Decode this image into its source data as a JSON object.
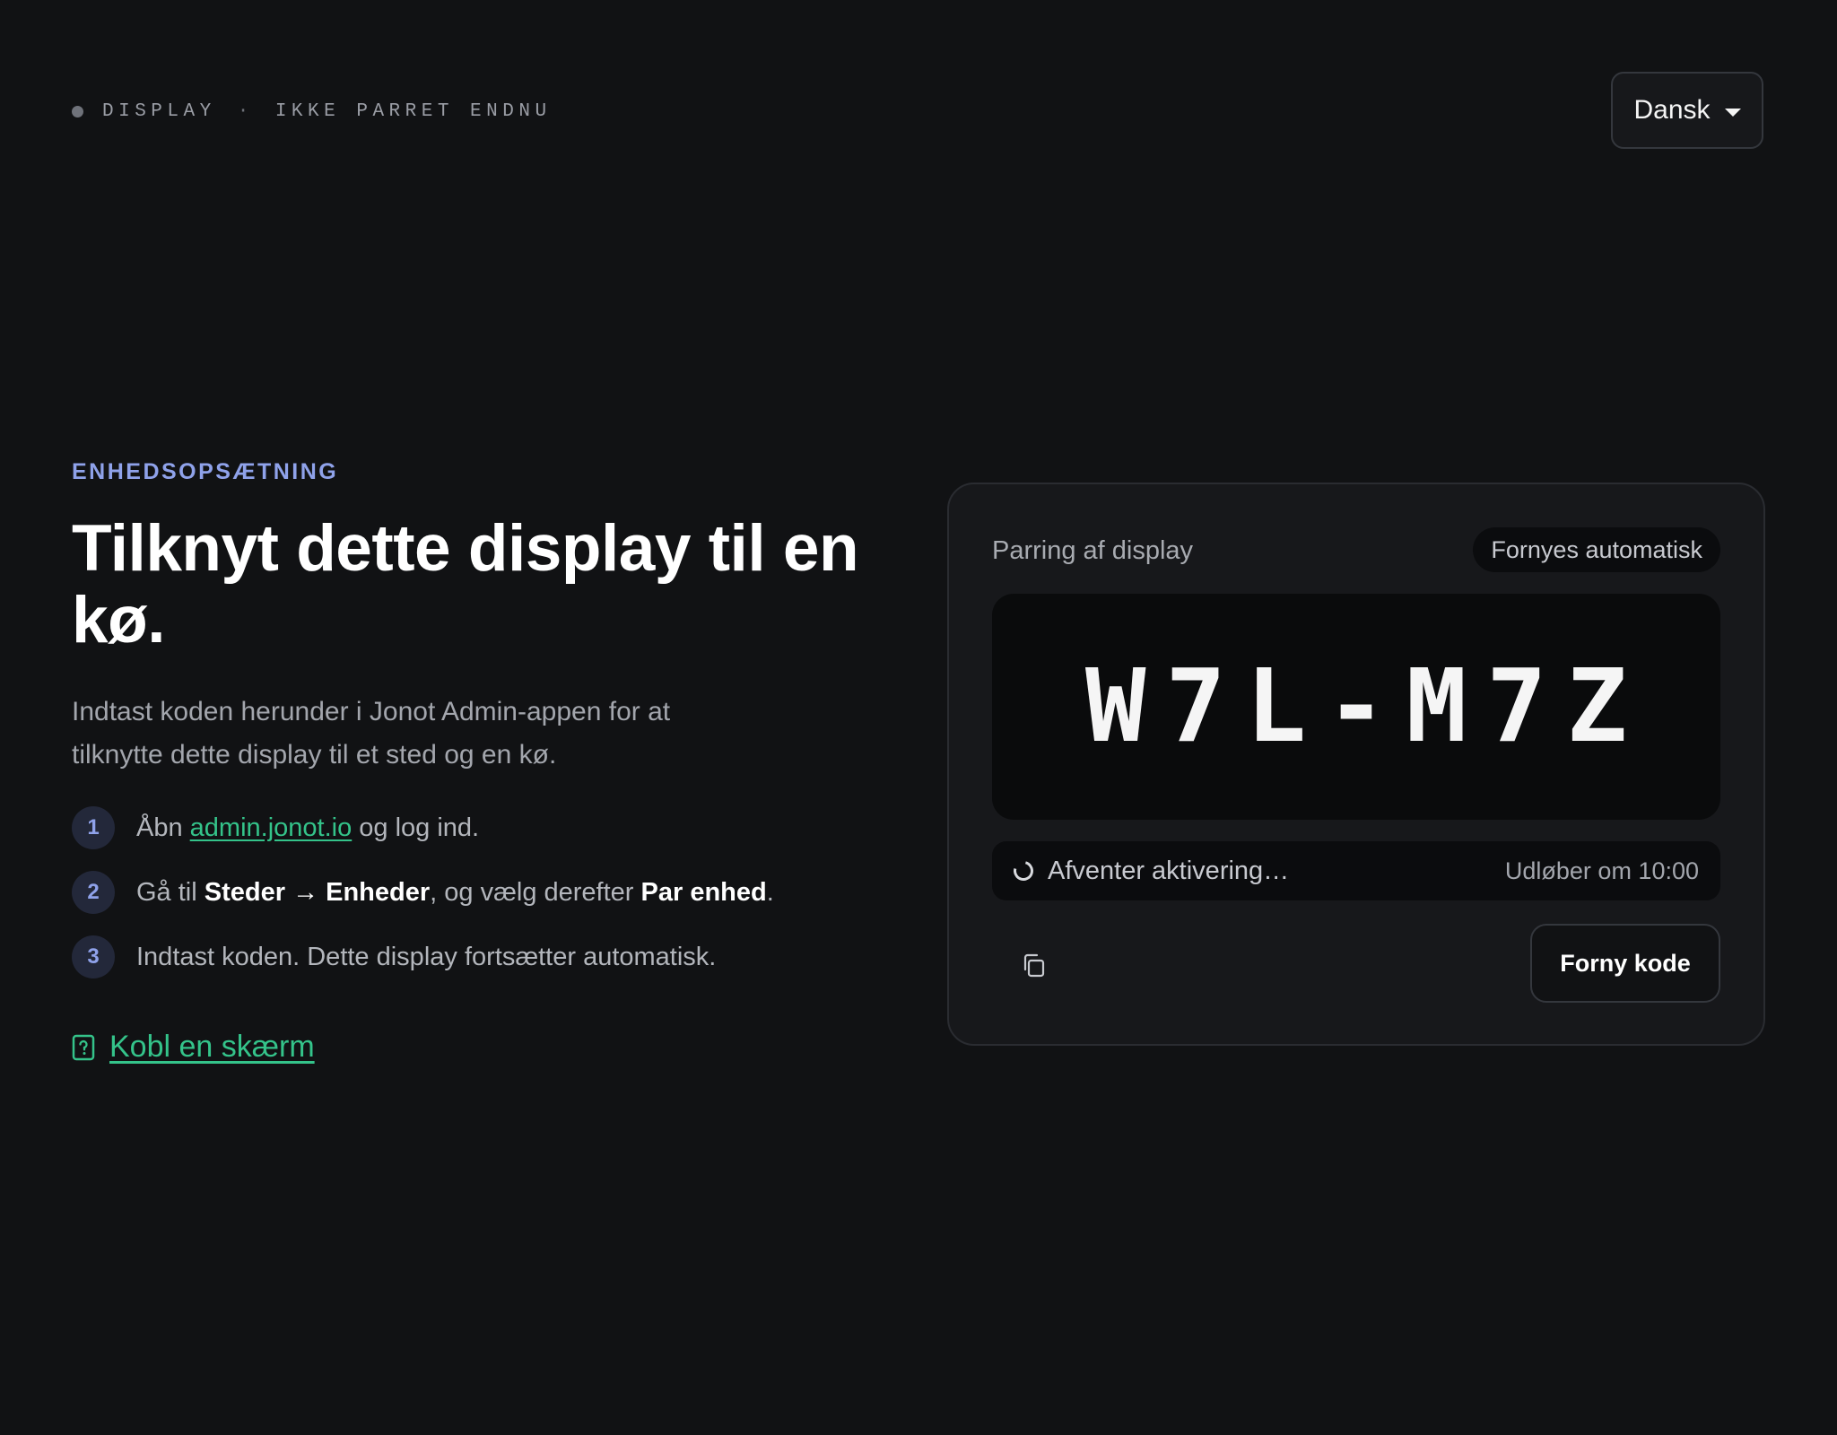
{
  "header": {
    "status_label": "DISPLAY",
    "status_separator": "·",
    "status_text": "IKKE PARRET ENDNU",
    "language": "Dansk"
  },
  "intro": {
    "eyebrow": "ENHEDSOPSÆTNING",
    "headline": "Tilknyt dette display til en kø.",
    "lead": "Indtast koden herunder i Jonot Admin-appen for at tilknytte dette display til et sted og en kø."
  },
  "steps": [
    {
      "num": "1",
      "a": "Åbn ",
      "link": "admin.jonot.io",
      "b": " og log ind."
    },
    {
      "num": "2",
      "a": "Gå til ",
      "bold1": "Steder → Enheder",
      "b": ", og vælg derefter ",
      "bold2": "Par enhed",
      "c": "."
    },
    {
      "num": "3",
      "a": "Indtast koden. Dette display fortsætter automatisk."
    }
  ],
  "help_link": "Kobl en skærm",
  "card": {
    "title": "Parring af display",
    "badge": "Fornyes automatisk",
    "code": "W7L-M7Z",
    "status": "Afventer aktivering…",
    "expires": "Udløber om 10:00",
    "renew_button": "Forny kode"
  },
  "colors": {
    "background": "#111214",
    "accent_blue": "#8fa2ea",
    "accent_green": "#34c38a"
  },
  "icons": {
    "status": "dot-icon",
    "language": "caret-down-icon",
    "help": "help-document-icon",
    "loading": "spinner-icon",
    "copy": "copy-icon"
  }
}
